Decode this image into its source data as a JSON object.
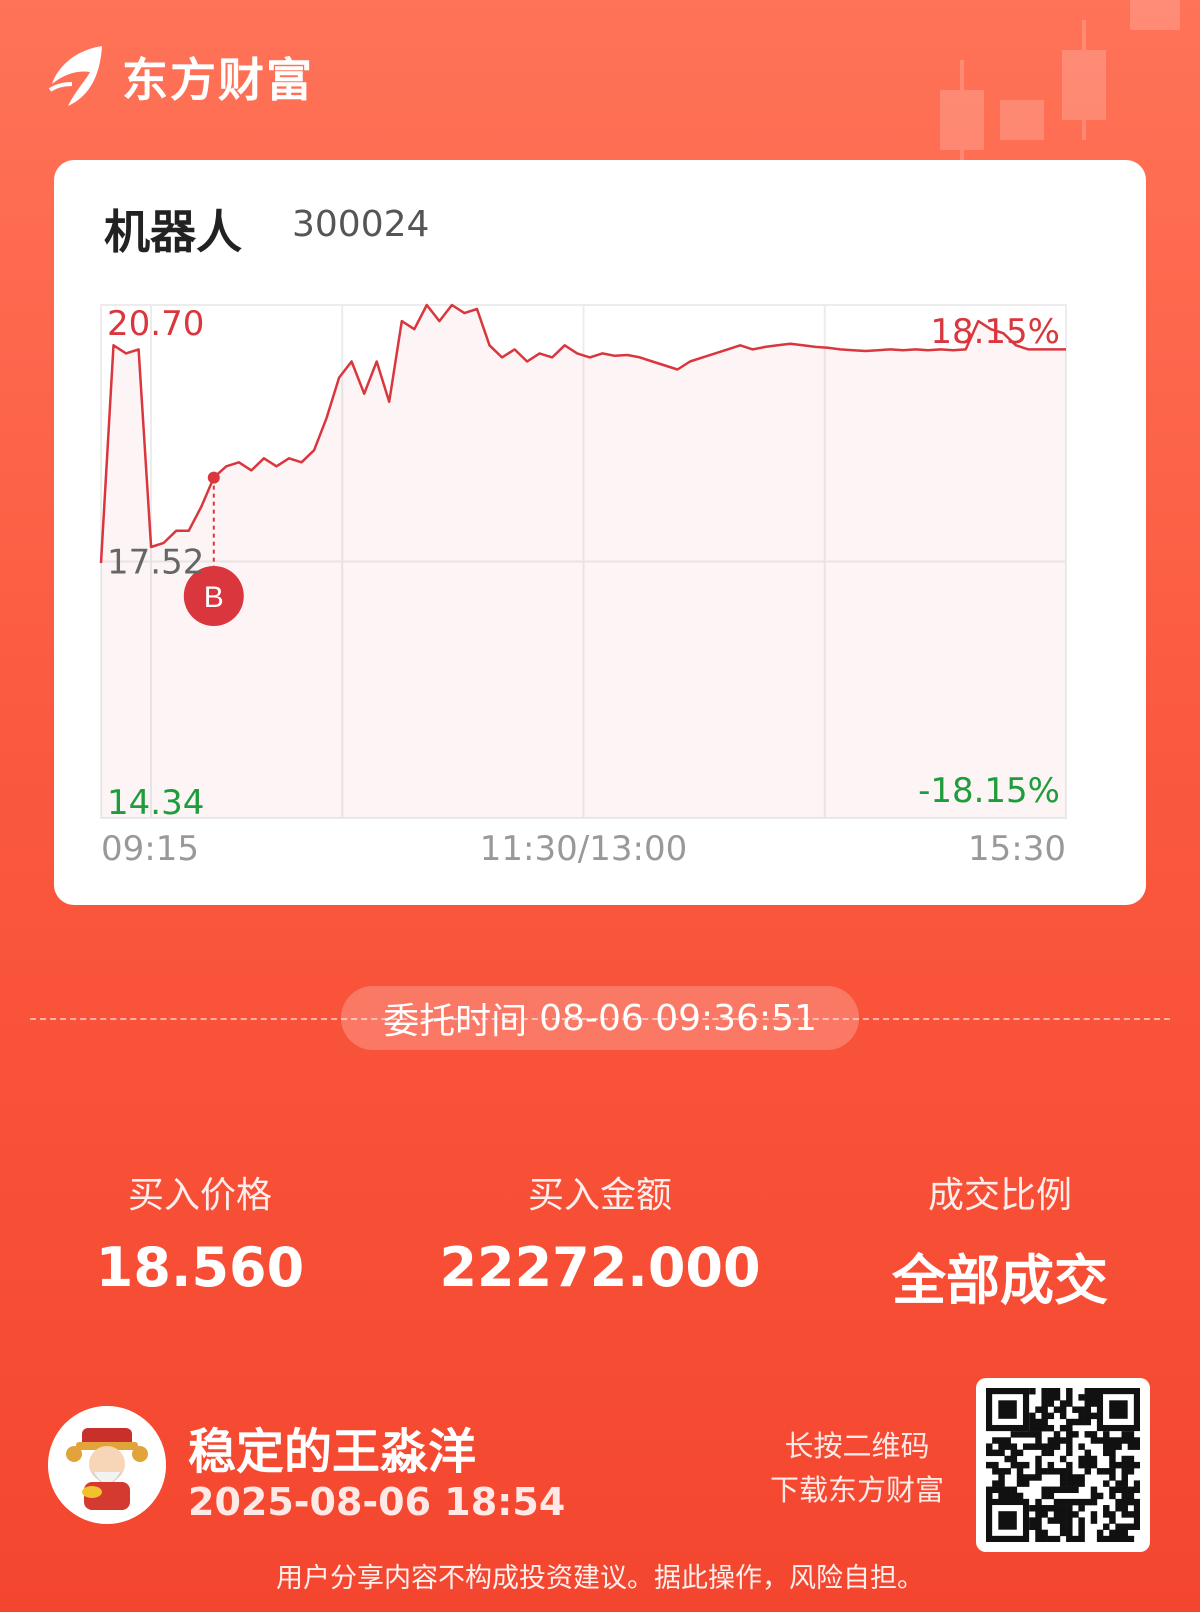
{
  "brand": {
    "name": "东方财富"
  },
  "stock": {
    "name": "机器人",
    "code": "300024"
  },
  "chart_data": {
    "type": "line",
    "title": "",
    "price_high_label": "20.70",
    "price_mid_label": "17.52",
    "price_low_label": "14.34",
    "pct_high_label": "18.15%",
    "pct_low_label": "-18.15%",
    "x_tick_labels": [
      "09:15",
      "11:30/13:00",
      "15:30"
    ],
    "ylim": [
      14.34,
      20.7
    ],
    "reference_price": 17.52,
    "buy_marker": {
      "label": "B",
      "price": 18.56
    },
    "series": [
      {
        "values": [
          17.5,
          20.2,
          20.1,
          20.15,
          17.7,
          17.75,
          17.9,
          17.9,
          18.2,
          18.56,
          18.7,
          18.75,
          18.65,
          18.8,
          18.7,
          18.8,
          18.75,
          18.9,
          19.3,
          19.8,
          20.0,
          19.6,
          20.0,
          19.5,
          20.5,
          20.4,
          20.7,
          20.5,
          20.7,
          20.6,
          20.65,
          20.2,
          20.05,
          20.15,
          20.0,
          20.1,
          20.05,
          20.2,
          20.1,
          20.05,
          20.1,
          20.07,
          20.08,
          20.05,
          20.0,
          19.95,
          19.9,
          20.0,
          20.05,
          20.1,
          20.15,
          20.2,
          20.15,
          20.18,
          20.2,
          20.22,
          20.2,
          20.18,
          20.17,
          20.15,
          20.14,
          20.13,
          20.14,
          20.15,
          20.14,
          20.15,
          20.14,
          20.15,
          20.14,
          20.15,
          20.5,
          20.4,
          20.35,
          20.2,
          20.15,
          20.15,
          20.15,
          20.15
        ]
      }
    ]
  },
  "order": {
    "time_label": "委托时间",
    "time_value": "08-06 09:36:51"
  },
  "stats": [
    {
      "label": "买入价格",
      "value": "18.560"
    },
    {
      "label": "买入金额",
      "value": "22272.000"
    },
    {
      "label": "成交比例",
      "value": "全部成交"
    }
  ],
  "user": {
    "name": "稳定的王淼洋",
    "share_time": "2025-08-06 18:54"
  },
  "qr": {
    "hint_line1": "长按二维码",
    "hint_line2": "下载东方财富"
  },
  "disclaimer": "用户分享内容不构成投资建议。据此操作，风险自担。",
  "colors": {
    "up": "#d9363e",
    "down": "#1f9c3b",
    "brand_bg": "#f4462f"
  }
}
